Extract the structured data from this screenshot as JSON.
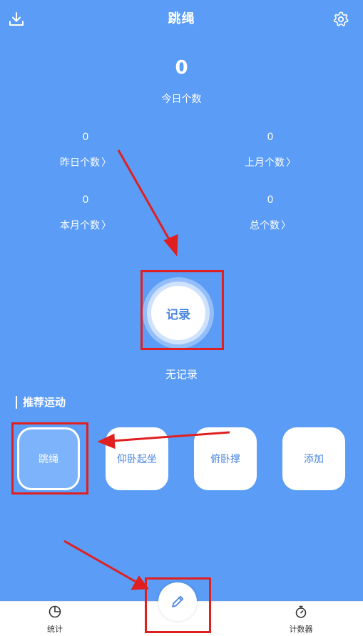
{
  "header": {
    "title": "跳绳"
  },
  "today": {
    "count": "0",
    "label": "今日个数"
  },
  "stats": [
    {
      "value": "0",
      "label": "昨日个数"
    },
    {
      "value": "0",
      "label": "上月个数"
    },
    {
      "value": "0",
      "label": "本月个数"
    },
    {
      "value": "0",
      "label": "总个数"
    }
  ],
  "record_button": {
    "label": "记录"
  },
  "empty_state": "无记录",
  "recommended": {
    "title": "推荐运动",
    "items": [
      {
        "label": "跳绳",
        "selected": true
      },
      {
        "label": "仰卧起坐",
        "selected": false
      },
      {
        "label": "俯卧撑",
        "selected": false
      },
      {
        "label": "添加",
        "selected": false
      }
    ]
  },
  "bottom_nav": {
    "items": [
      {
        "label": "统计",
        "icon": "pie-chart-icon"
      },
      {
        "label": "计数器",
        "icon": "stopwatch-icon"
      }
    ],
    "fab_icon": "pencil-icon"
  },
  "colors": {
    "primary": "#5a9cf6",
    "accent": "#4a86e0",
    "annotation": "#e02020"
  }
}
